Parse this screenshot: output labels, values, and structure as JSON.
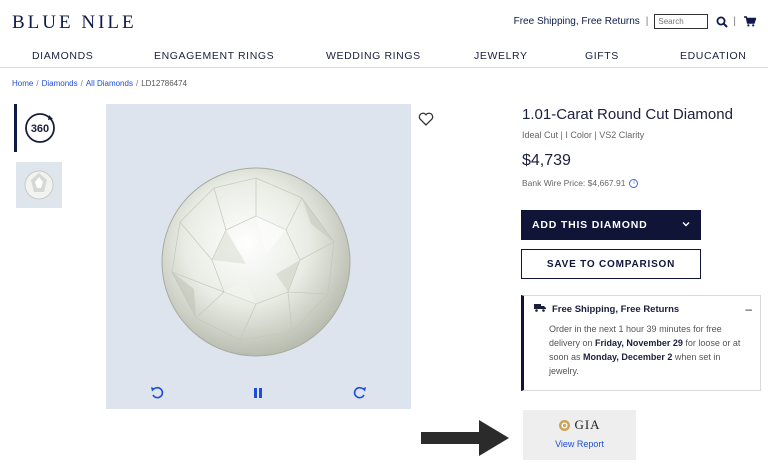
{
  "header": {
    "logo": "BLUE NILE",
    "shipping": "Free Shipping, Free Returns",
    "separator": "|",
    "search_placeholder": "Search"
  },
  "nav": {
    "items": [
      "DIAMONDS",
      "ENGAGEMENT RINGS",
      "WEDDING RINGS",
      "JEWELRY",
      "GIFTS",
      "EDUCATION"
    ]
  },
  "breadcrumb": {
    "items": [
      "Home",
      "Diamonds",
      "All Diamonds"
    ],
    "current": "LD12786474",
    "separator": "/"
  },
  "gallery": {
    "thumb_360_label": "360"
  },
  "product": {
    "title": "1.01-Carat Round Cut Diamond",
    "subtitle": "Ideal Cut | I Color | VS2 Clarity",
    "price": "$4,739",
    "wire_price": "Bank Wire Price: $4,667.91",
    "add_button": "ADD THIS DIAMOND",
    "compare_button": "SAVE TO COMPARISON"
  },
  "shipping_panel": {
    "title": "Free Shipping, Free Returns",
    "collapse": "–",
    "text_1": "Order in the next 1 hour 39 minutes for free delivery on ",
    "date_1": "Friday, November 29",
    "text_2": " for loose or at soon as ",
    "date_2": "Monday, December 2",
    "text_3": " when set in jewelry."
  },
  "gia": {
    "logo": "GIA",
    "link": "View Report"
  },
  "colors": {
    "navy": "#101538",
    "link": "#1f4fd8",
    "viewer_bg": "#dde4ed"
  }
}
